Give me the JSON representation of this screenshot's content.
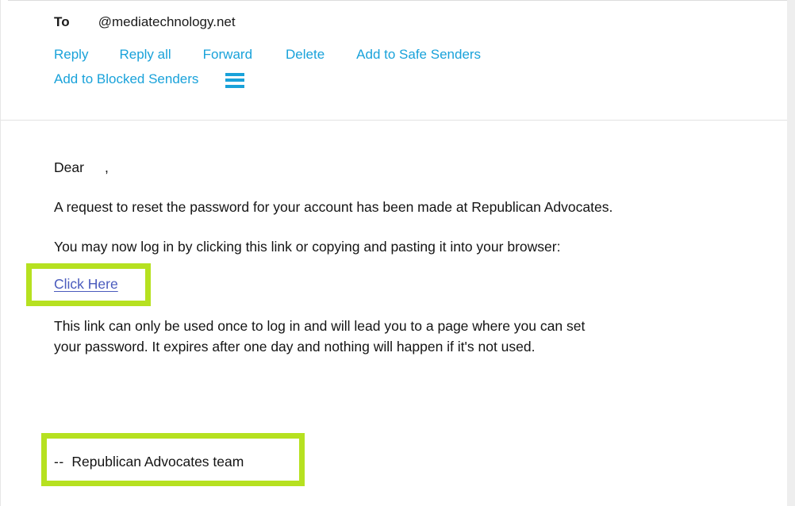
{
  "window": {
    "kind": "email-reading-pane"
  },
  "colors": {
    "link_blue": "#19a2da",
    "highlight_green": "#b6e120",
    "body_link": "#4a5bbd",
    "body_text": "#141414",
    "scrollbar_track": "#eeeeee"
  },
  "header": {
    "to_label": "To",
    "to_address": "@mediatechnology.net",
    "actions_row1": [
      {
        "label": "Reply",
        "name": "reply"
      },
      {
        "label": "Reply all",
        "name": "reply-all"
      },
      {
        "label": "Forward",
        "name": "forward"
      },
      {
        "label": "Delete",
        "name": "delete"
      },
      {
        "label": "Add to Safe Senders",
        "name": "add-to-safe-senders"
      }
    ],
    "actions_row2": [
      {
        "label": "Add to Blocked Senders",
        "name": "add-to-blocked-senders"
      }
    ],
    "more_menu_icon": "hamburger-icon"
  },
  "body": {
    "greeting_prefix": "Dear",
    "greeting_suffix": ",",
    "paragraph_request": "A request to reset the password for your account has been made at Republican Advocates.",
    "paragraph_login": "You may now log in by clicking this link or copying and pasting it into your browser:",
    "link_label": "Click Here",
    "paragraph_info_line1": "This link can only be used once to log in and will lead you to a page where you can set",
    "paragraph_info_line2": "your password. It expires after one day and nothing will happen if it's not used.",
    "signature_dashes": "--",
    "signature_text": "Republican Advocates team"
  }
}
